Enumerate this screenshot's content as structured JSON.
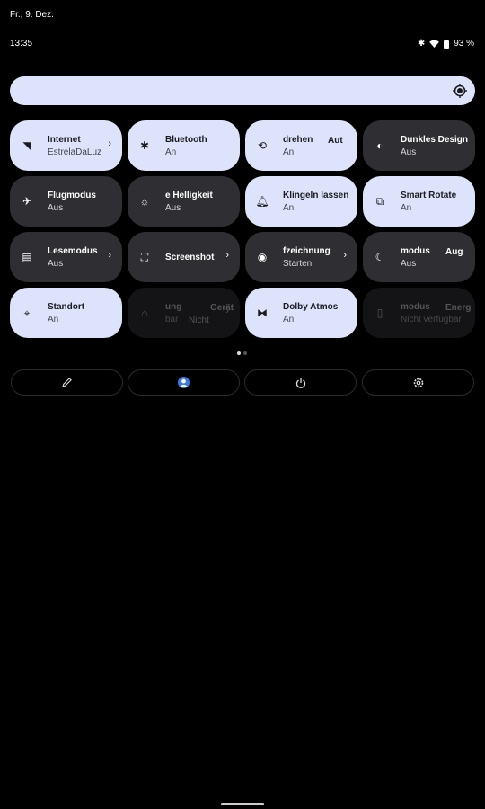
{
  "status_bar": {
    "date": "Fr., 9. Dez.",
    "time": "13:35",
    "battery": "93 %"
  },
  "brightness": {
    "level": 0.0
  },
  "tiles": [
    {
      "title": "Internet",
      "subtitle": "EstrelaDaLuz",
      "icon": "wifi-icon",
      "state": "on",
      "chevron": true
    },
    {
      "title": "Bluetooth",
      "subtitle": "An",
      "icon": "bluetooth-icon",
      "state": "on"
    },
    {
      "title": "drehen",
      "extra": "Aut",
      "subtitle": "An",
      "icon": "auto-rotate-icon",
      "state": "on"
    },
    {
      "title": "Dunkles Design",
      "subtitle": "Aus",
      "icon": "dark-theme-icon",
      "state": "off"
    },
    {
      "title": "Flugmodus",
      "subtitle": "Aus",
      "icon": "airplane-icon",
      "state": "off"
    },
    {
      "title": "e Helligkeit",
      "subtitle": "Aus",
      "icon": "auto-brightness-icon",
      "state": "off"
    },
    {
      "title": "Klingeln lassen",
      "subtitle": "An",
      "icon": "bell-icon",
      "state": "on"
    },
    {
      "title": "Smart Rotate",
      "subtitle": "An",
      "icon": "smart-rotate-icon",
      "state": "on"
    },
    {
      "title": "Lesemodus",
      "subtitle": "Aus",
      "icon": "reading-mode-icon",
      "state": "off",
      "chevron": true
    },
    {
      "title": "Screenshot",
      "subtitle": "",
      "icon": "screenshot-icon",
      "state": "off",
      "chevron": true
    },
    {
      "title": "fzeichnung",
      "subtitle": "Starten",
      "icon": "screen-record-icon",
      "state": "off",
      "chevron": true
    },
    {
      "title": "modus",
      "extra": "Aug",
      "subtitle": "Aus",
      "icon": "moon-icon",
      "state": "off"
    },
    {
      "title": "Standort",
      "subtitle": "An",
      "icon": "location-icon",
      "state": "on"
    },
    {
      "title": "ung",
      "extra": "Gerät",
      "subtitle": "bar",
      "extra2": "Nicht",
      "icon": "home-icon",
      "state": "unavailable",
      "chevron": true
    },
    {
      "title": "Dolby Atmos",
      "subtitle": "An",
      "icon": "dolby-icon",
      "state": "on"
    },
    {
      "title": "modus",
      "extra": "Energ",
      "subtitle": "Nicht verfügbar",
      "icon": "battery-saver-icon",
      "state": "unavailable"
    }
  ],
  "footer": [
    {
      "icon": "edit-icon"
    },
    {
      "icon": "user-icon"
    },
    {
      "icon": "power-icon"
    },
    {
      "icon": "settings-icon"
    }
  ],
  "colors": {
    "tile_on": "#dde3fb",
    "tile_off": "#2e2e33",
    "tile_unavailable": "#141416",
    "background": "#000000"
  }
}
